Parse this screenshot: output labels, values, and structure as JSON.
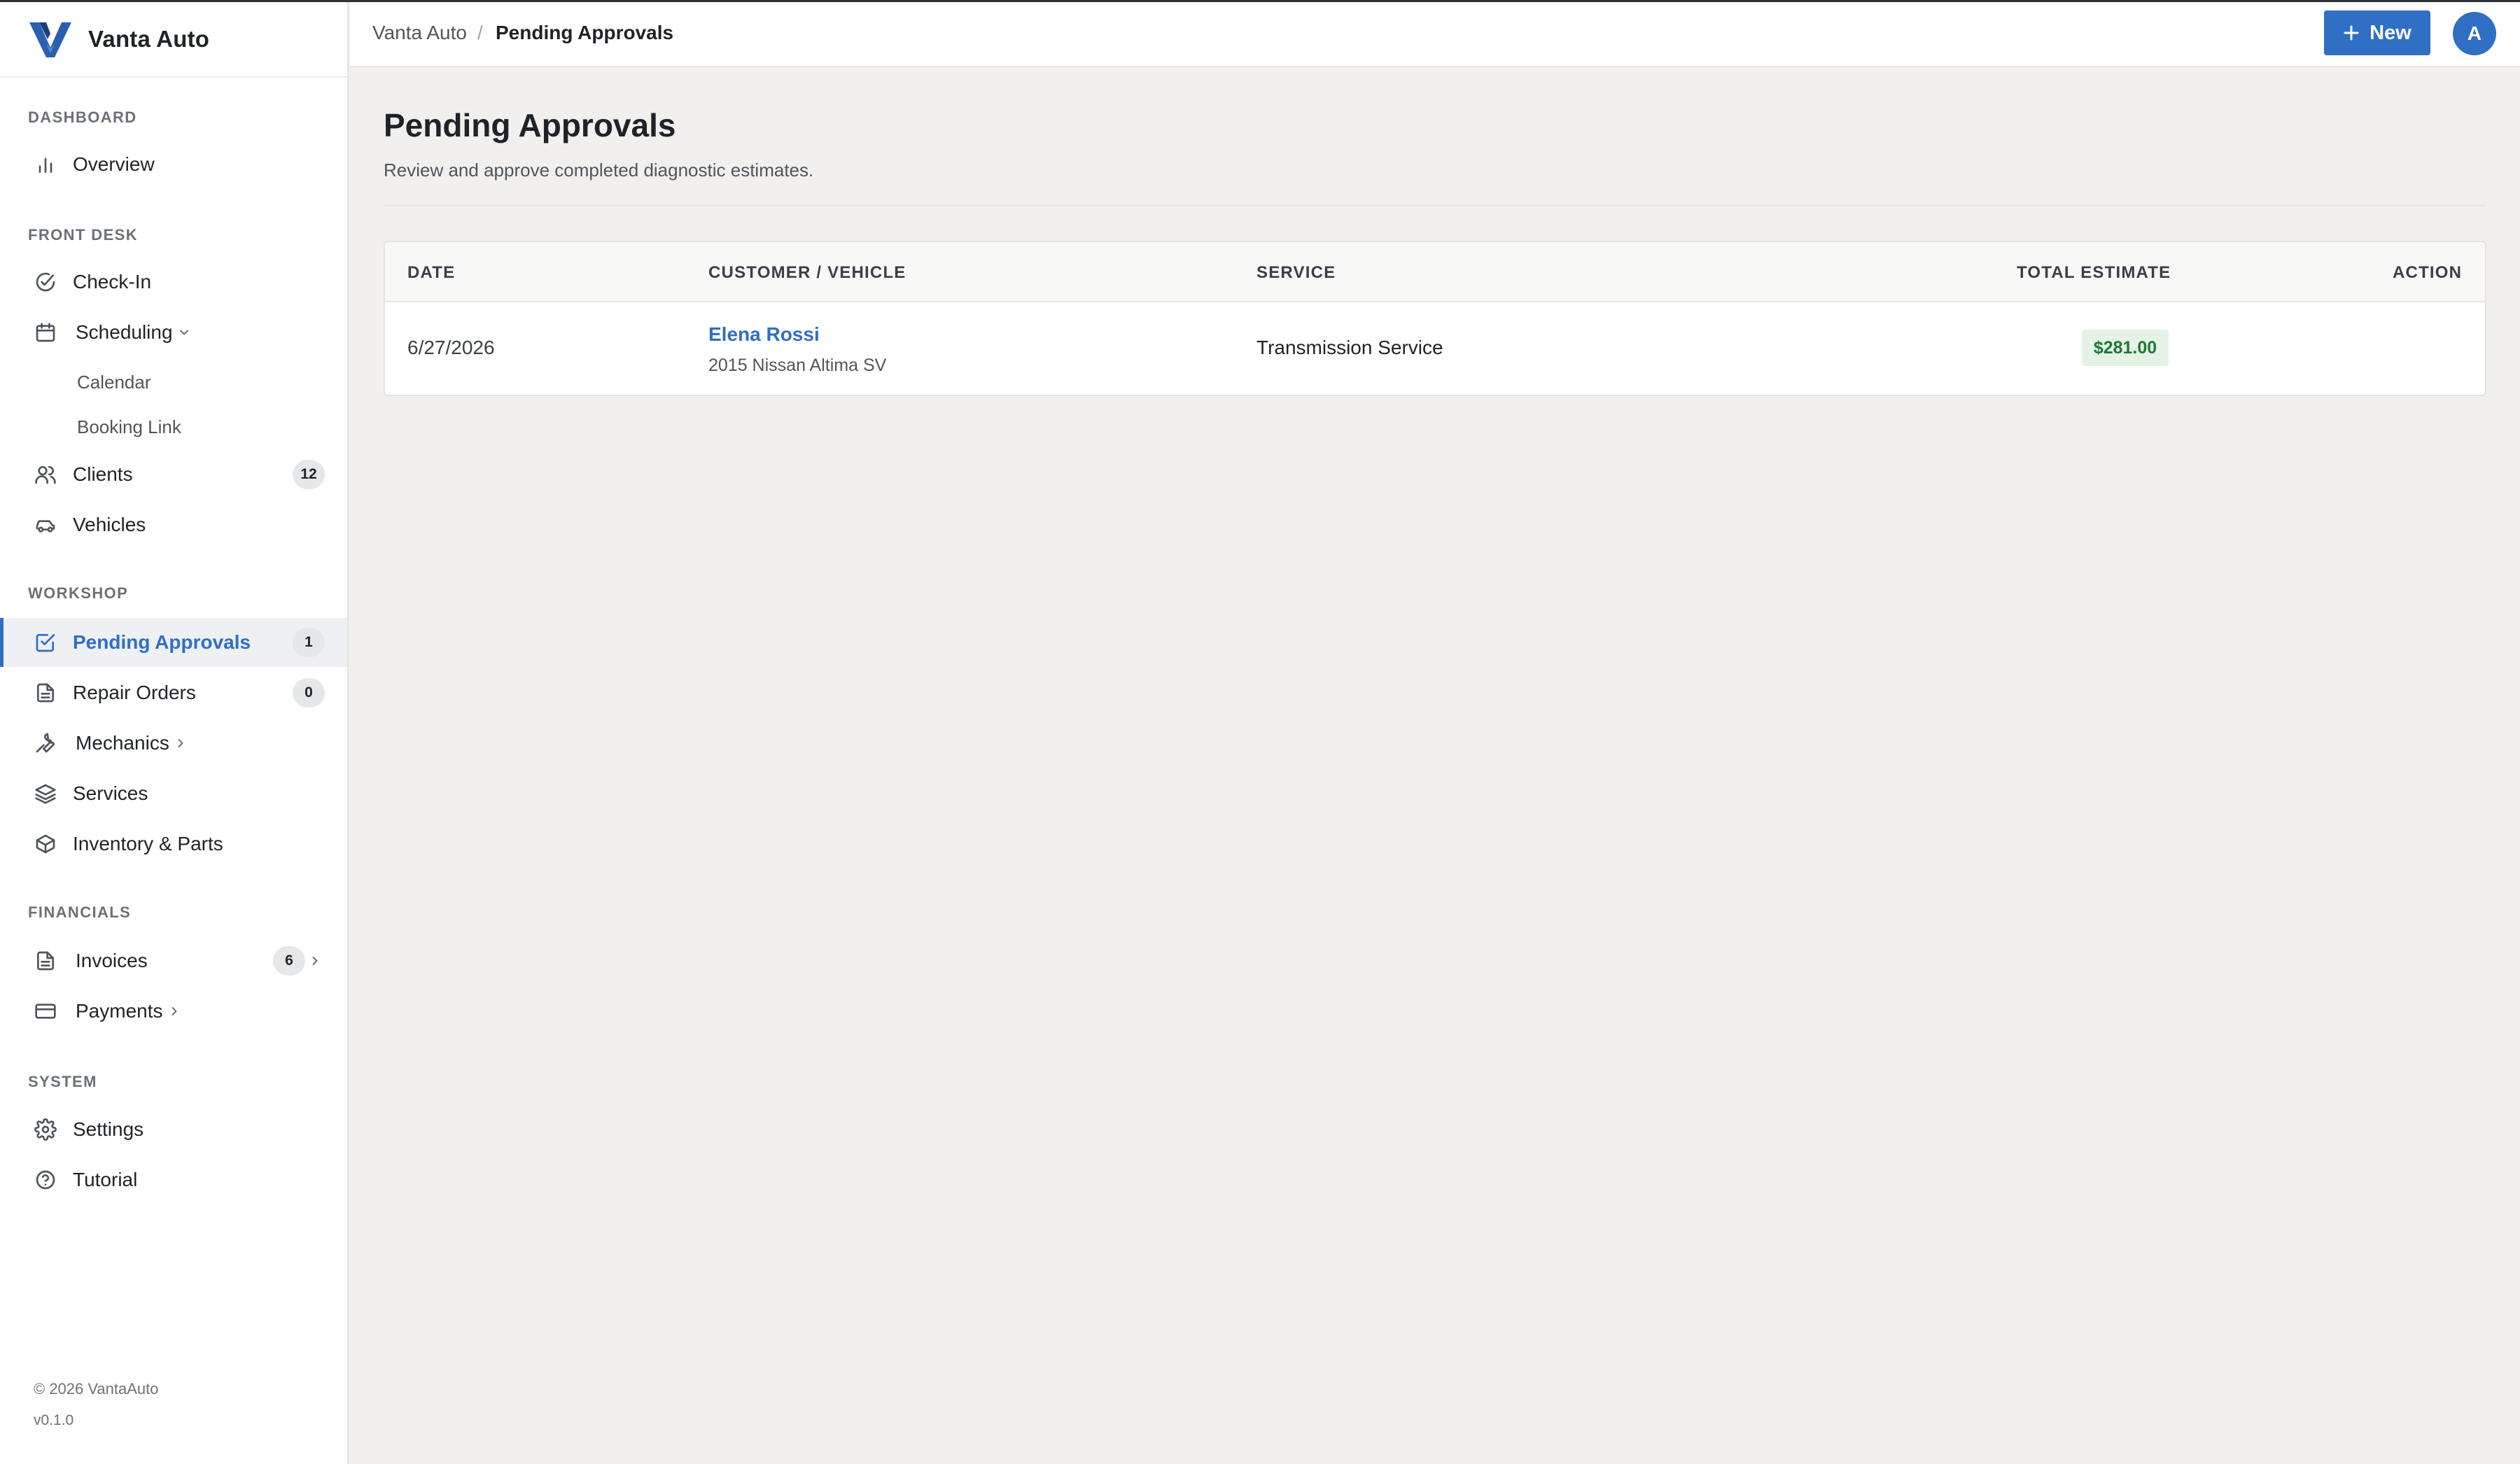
{
  "app": {
    "name": "Vanta Auto",
    "brand_color": "#2f6fc4"
  },
  "sidebar": {
    "sections": [
      {
        "label": "DASHBOARD"
      },
      {
        "label": "FRONT DESK"
      },
      {
        "label": "WORKSHOP"
      },
      {
        "label": "FINANCIALS"
      },
      {
        "label": "SYSTEM"
      }
    ],
    "items": {
      "overview": {
        "label": "Overview",
        "icon": "bar-chart-icon"
      },
      "checkin": {
        "label": "Check-In",
        "icon": "check-circle-icon"
      },
      "scheduling": {
        "label": "Scheduling",
        "icon": "calendar-icon"
      },
      "calendar": {
        "label": "Calendar"
      },
      "booking_link": {
        "label": "Booking Link"
      },
      "clients": {
        "label": "Clients",
        "icon": "users-icon",
        "badge": "12"
      },
      "vehicles": {
        "label": "Vehicles",
        "icon": "car-icon"
      },
      "pending_approvals": {
        "label": "Pending Approvals",
        "icon": "check-square-icon",
        "badge": "1"
      },
      "repair_orders": {
        "label": "Repair Orders",
        "icon": "document-icon",
        "badge": "0"
      },
      "mechanics": {
        "label": "Mechanics",
        "icon": "wrench-icon"
      },
      "services": {
        "label": "Services",
        "icon": "layers-icon"
      },
      "inventory": {
        "label": "Inventory & Parts",
        "icon": "box-icon"
      },
      "invoices": {
        "label": "Invoices",
        "icon": "document-icon",
        "badge": "6"
      },
      "payments": {
        "label": "Payments",
        "icon": "credit-card-icon"
      },
      "settings": {
        "label": "Settings",
        "icon": "gear-icon"
      },
      "tutorial": {
        "label": "Tutorial",
        "icon": "help-circle-icon"
      }
    },
    "footer": {
      "copyright": "© 2026 VantaAuto",
      "version": "v0.1.0"
    }
  },
  "topbar": {
    "breadcrumb_root": "Vanta Auto",
    "breadcrumb_sep": "/",
    "breadcrumb_current": "Pending Approvals",
    "new_button": "New",
    "avatar_initial": "A"
  },
  "main": {
    "title": "Pending Approvals",
    "subtitle": "Review and approve completed diagnostic estimates.",
    "table": {
      "headers": {
        "date": "DATE",
        "customer": "CUSTOMER / VEHICLE",
        "service": "SERVICE",
        "total": "TOTAL ESTIMATE",
        "action": "ACTION"
      },
      "rows": [
        {
          "date": "6/27/2026",
          "customer": "Elena Rossi",
          "vehicle": "2015 Nissan Altima SV",
          "service": "Transmission Service",
          "total": "$281.00"
        }
      ]
    }
  }
}
